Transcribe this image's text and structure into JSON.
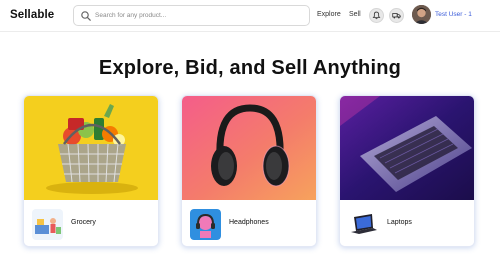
{
  "header": {
    "brand": "Sellable",
    "search_placeholder": "Search for any product...",
    "nav": [
      {
        "label": "Explore"
      },
      {
        "label": "Sell"
      }
    ],
    "user_name": "Test User - 1"
  },
  "hero": {
    "title": "Explore, Bid, and Sell Anything"
  },
  "categories": [
    {
      "label": "Grocery",
      "image": "grocery-basket",
      "thumb": "grocery-thumb"
    },
    {
      "label": "Headphones",
      "image": "headphones",
      "thumb": "headphones-thumb"
    },
    {
      "label": "Laptops",
      "image": "laptop",
      "thumb": "laptop-thumb"
    }
  ],
  "colors": {
    "accent_link": "#3a5bd9",
    "grocery_bg": "#f4cf1e",
    "headphones_bg": "#f07a6a",
    "laptop_bg": "#3a1c78"
  }
}
